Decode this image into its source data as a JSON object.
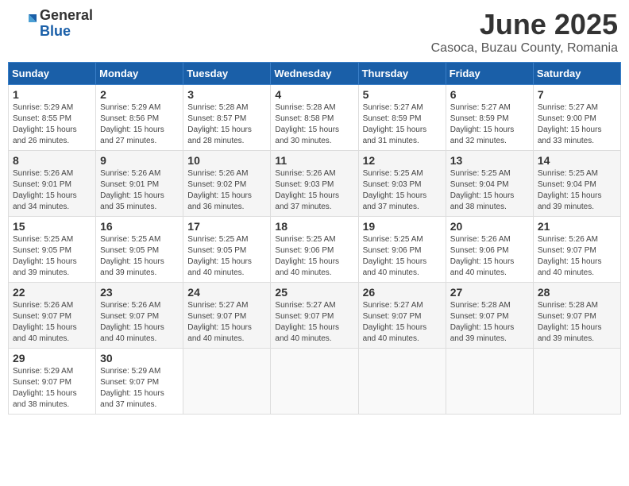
{
  "header": {
    "logo_general": "General",
    "logo_blue": "Blue",
    "month": "June 2025",
    "location": "Casoca, Buzau County, Romania"
  },
  "weekdays": [
    "Sunday",
    "Monday",
    "Tuesday",
    "Wednesday",
    "Thursday",
    "Friday",
    "Saturday"
  ],
  "weeks": [
    [
      {
        "day": "1",
        "info": "Sunrise: 5:29 AM\nSunset: 8:55 PM\nDaylight: 15 hours\nand 26 minutes."
      },
      {
        "day": "2",
        "info": "Sunrise: 5:29 AM\nSunset: 8:56 PM\nDaylight: 15 hours\nand 27 minutes."
      },
      {
        "day": "3",
        "info": "Sunrise: 5:28 AM\nSunset: 8:57 PM\nDaylight: 15 hours\nand 28 minutes."
      },
      {
        "day": "4",
        "info": "Sunrise: 5:28 AM\nSunset: 8:58 PM\nDaylight: 15 hours\nand 30 minutes."
      },
      {
        "day": "5",
        "info": "Sunrise: 5:27 AM\nSunset: 8:59 PM\nDaylight: 15 hours\nand 31 minutes."
      },
      {
        "day": "6",
        "info": "Sunrise: 5:27 AM\nSunset: 8:59 PM\nDaylight: 15 hours\nand 32 minutes."
      },
      {
        "day": "7",
        "info": "Sunrise: 5:27 AM\nSunset: 9:00 PM\nDaylight: 15 hours\nand 33 minutes."
      }
    ],
    [
      {
        "day": "8",
        "info": "Sunrise: 5:26 AM\nSunset: 9:01 PM\nDaylight: 15 hours\nand 34 minutes."
      },
      {
        "day": "9",
        "info": "Sunrise: 5:26 AM\nSunset: 9:01 PM\nDaylight: 15 hours\nand 35 minutes."
      },
      {
        "day": "10",
        "info": "Sunrise: 5:26 AM\nSunset: 9:02 PM\nDaylight: 15 hours\nand 36 minutes."
      },
      {
        "day": "11",
        "info": "Sunrise: 5:26 AM\nSunset: 9:03 PM\nDaylight: 15 hours\nand 37 minutes."
      },
      {
        "day": "12",
        "info": "Sunrise: 5:25 AM\nSunset: 9:03 PM\nDaylight: 15 hours\nand 37 minutes."
      },
      {
        "day": "13",
        "info": "Sunrise: 5:25 AM\nSunset: 9:04 PM\nDaylight: 15 hours\nand 38 minutes."
      },
      {
        "day": "14",
        "info": "Sunrise: 5:25 AM\nSunset: 9:04 PM\nDaylight: 15 hours\nand 39 minutes."
      }
    ],
    [
      {
        "day": "15",
        "info": "Sunrise: 5:25 AM\nSunset: 9:05 PM\nDaylight: 15 hours\nand 39 minutes."
      },
      {
        "day": "16",
        "info": "Sunrise: 5:25 AM\nSunset: 9:05 PM\nDaylight: 15 hours\nand 39 minutes."
      },
      {
        "day": "17",
        "info": "Sunrise: 5:25 AM\nSunset: 9:05 PM\nDaylight: 15 hours\nand 40 minutes."
      },
      {
        "day": "18",
        "info": "Sunrise: 5:25 AM\nSunset: 9:06 PM\nDaylight: 15 hours\nand 40 minutes."
      },
      {
        "day": "19",
        "info": "Sunrise: 5:25 AM\nSunset: 9:06 PM\nDaylight: 15 hours\nand 40 minutes."
      },
      {
        "day": "20",
        "info": "Sunrise: 5:26 AM\nSunset: 9:06 PM\nDaylight: 15 hours\nand 40 minutes."
      },
      {
        "day": "21",
        "info": "Sunrise: 5:26 AM\nSunset: 9:07 PM\nDaylight: 15 hours\nand 40 minutes."
      }
    ],
    [
      {
        "day": "22",
        "info": "Sunrise: 5:26 AM\nSunset: 9:07 PM\nDaylight: 15 hours\nand 40 minutes."
      },
      {
        "day": "23",
        "info": "Sunrise: 5:26 AM\nSunset: 9:07 PM\nDaylight: 15 hours\nand 40 minutes."
      },
      {
        "day": "24",
        "info": "Sunrise: 5:27 AM\nSunset: 9:07 PM\nDaylight: 15 hours\nand 40 minutes."
      },
      {
        "day": "25",
        "info": "Sunrise: 5:27 AM\nSunset: 9:07 PM\nDaylight: 15 hours\nand 40 minutes."
      },
      {
        "day": "26",
        "info": "Sunrise: 5:27 AM\nSunset: 9:07 PM\nDaylight: 15 hours\nand 40 minutes."
      },
      {
        "day": "27",
        "info": "Sunrise: 5:28 AM\nSunset: 9:07 PM\nDaylight: 15 hours\nand 39 minutes."
      },
      {
        "day": "28",
        "info": "Sunrise: 5:28 AM\nSunset: 9:07 PM\nDaylight: 15 hours\nand 39 minutes."
      }
    ],
    [
      {
        "day": "29",
        "info": "Sunrise: 5:29 AM\nSunset: 9:07 PM\nDaylight: 15 hours\nand 38 minutes."
      },
      {
        "day": "30",
        "info": "Sunrise: 5:29 AM\nSunset: 9:07 PM\nDaylight: 15 hours\nand 37 minutes."
      },
      {
        "day": "",
        "info": ""
      },
      {
        "day": "",
        "info": ""
      },
      {
        "day": "",
        "info": ""
      },
      {
        "day": "",
        "info": ""
      },
      {
        "day": "",
        "info": ""
      }
    ]
  ]
}
